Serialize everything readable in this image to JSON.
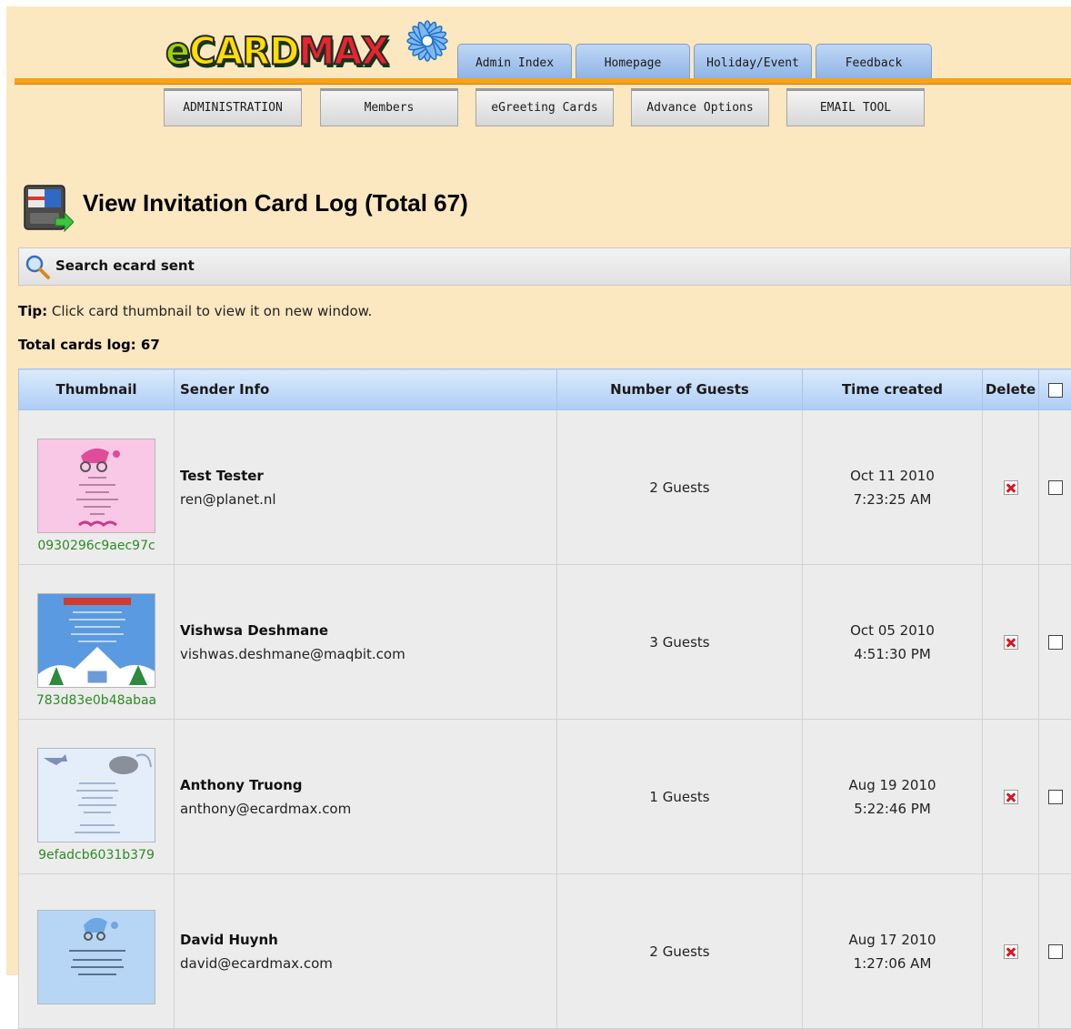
{
  "brand": {
    "logo_text_e": "e",
    "logo_text_card": "CARD",
    "logo_text_max": "MAX"
  },
  "top_tabs": [
    "Admin Index",
    "Homepage",
    "Holiday/Event",
    "Feedback"
  ],
  "sub_nav": [
    "ADMINISTRATION",
    "Members",
    "eGreeting Cards",
    "Advance Options",
    "EMAIL TOOL"
  ],
  "page": {
    "title": "View Invitation Card Log (Total 67)",
    "search_label": "Search ecard sent",
    "tip_label": "Tip:",
    "tip_text": " Click card thumbnail to view it on new window.",
    "total_label": "Total cards log: 67"
  },
  "table": {
    "headers": {
      "thumbnail": "Thumbnail",
      "sender": "Sender Info",
      "guests": "Number of Guests",
      "time": "Time created",
      "delete": "Delete"
    },
    "rows": [
      {
        "code": "0930296c9aec97c",
        "name": "Test Tester",
        "email": "ren@planet.nl",
        "guests": "2 Guests",
        "date": "Oct 11 2010",
        "time": "7:23:25 AM",
        "thumb_style": "pink"
      },
      {
        "code": "783d83e0b48abaa",
        "name": "Vishwsa Deshmane",
        "email": "vishwas.deshmane@maqbit.com",
        "guests": "3 Guests",
        "date": "Oct 05 2010",
        "time": "4:51:30 PM",
        "thumb_style": "blue-christmas"
      },
      {
        "code": "9efadcb6031b379",
        "name": "Anthony Truong",
        "email": "anthony@ecardmax.com",
        "guests": "1 Guests",
        "date": "Aug 19 2010",
        "time": "5:22:46 PM",
        "thumb_style": "light-blue"
      },
      {
        "code": "",
        "name": "David Huynh",
        "email": "david@ecardmax.com",
        "guests": "2 Guests",
        "date": "Aug 17 2010",
        "time": "1:27:06 AM",
        "thumb_style": "baby-blue"
      }
    ]
  },
  "colors": {
    "page_bg": "#fbe7c0",
    "accent_orange": "#f7a21a",
    "tab_blue": "#9fc0ea",
    "code_green": "#2d8a25"
  }
}
